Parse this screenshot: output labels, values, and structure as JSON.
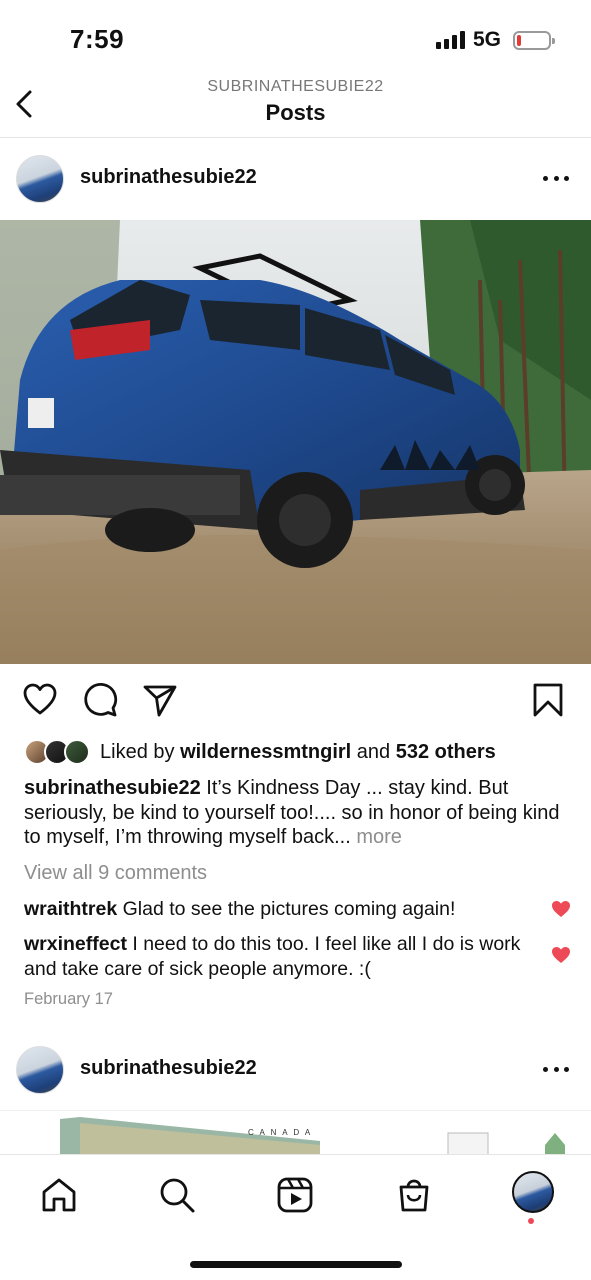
{
  "status": {
    "time": "7:59",
    "network": "5G"
  },
  "header": {
    "subtitle": "SUBRINATHESUBIE22",
    "title": "Posts"
  },
  "post1": {
    "username": "subrinathesubie22",
    "image_alt": "Blue Subaru Outback Wilderness with roof rack parked on a dirt trail among pine trees",
    "likes": {
      "prefix": "Liked by ",
      "liker": "wildernessmtngirl",
      "middle": " and ",
      "count": "532 others"
    },
    "caption": {
      "username": "subrinathesubie22",
      "text": " It’s Kindness Day ... stay kind. But seriously, be kind to yourself too!.... so in honor of being kind to myself, I’m throwing myself back...",
      "more": " more"
    },
    "view_comments": "View all 9 comments",
    "comments": [
      {
        "username": "wraithtrek",
        "text": " Glad to see the pictures coming again!"
      },
      {
        "username": "wrxineffect",
        "text": " I need to do this too. I feel like all I do is work and take care of sick people anymore. :("
      }
    ],
    "date": "February 17"
  },
  "post2": {
    "username": "subrinathesubie22",
    "map_label": "C A N A D A"
  },
  "icons": {
    "back": "chevron-left-icon",
    "more": "more-horizontal-icon",
    "like": "heart-icon",
    "comment": "comment-icon",
    "share": "send-icon",
    "save": "bookmark-icon",
    "home": "home-icon",
    "search": "search-icon",
    "reels": "reels-icon",
    "shop": "shopping-bag-icon"
  },
  "colors": {
    "like_red": "#ed4956",
    "muted": "#8e8e8e",
    "battery_low": "#e53935"
  }
}
